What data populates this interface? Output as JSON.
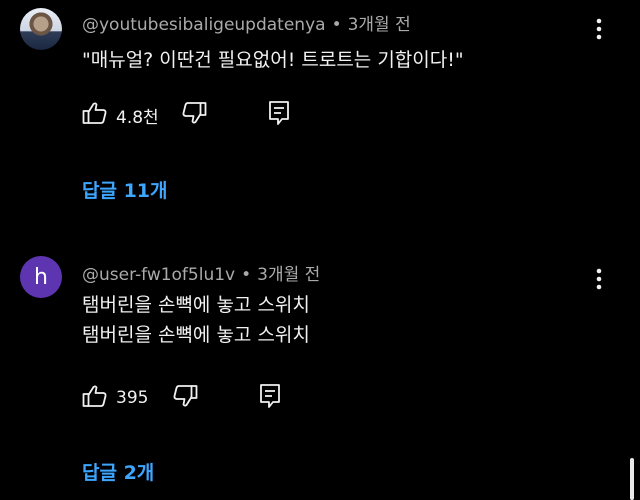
{
  "comments": [
    {
      "author": "@youtubesibaligeupdatenya",
      "separator": "•",
      "time": "3개월 전",
      "lines": [
        "\"매뉴얼? 이딴건 필요없어! 트로트는 기합이다!\""
      ],
      "likes": "4.8천",
      "replies_label": "답글 11개",
      "avatar_type": "photo"
    },
    {
      "author": "@user-fw1of5lu1v",
      "separator": "•",
      "time": "3개월 전",
      "lines": [
        "탬버린을 손뼉에 놓고 스위치",
        "탬버린을 손뼉에 놓고 스위치"
      ],
      "likes": "395",
      "replies_label": "답글 2개",
      "avatar_type": "letter",
      "avatar_letter": "h",
      "avatar_color": "#5e35b1"
    }
  ],
  "icons": {
    "like": "thumbs-up-icon",
    "dislike": "thumbs-down-icon",
    "reply": "comment-icon",
    "menu": "more-vert-icon"
  },
  "colors": {
    "background": "#000000",
    "link": "#3ea6ff",
    "text": "#f1f1f1",
    "meta": "#aaaaaa"
  }
}
